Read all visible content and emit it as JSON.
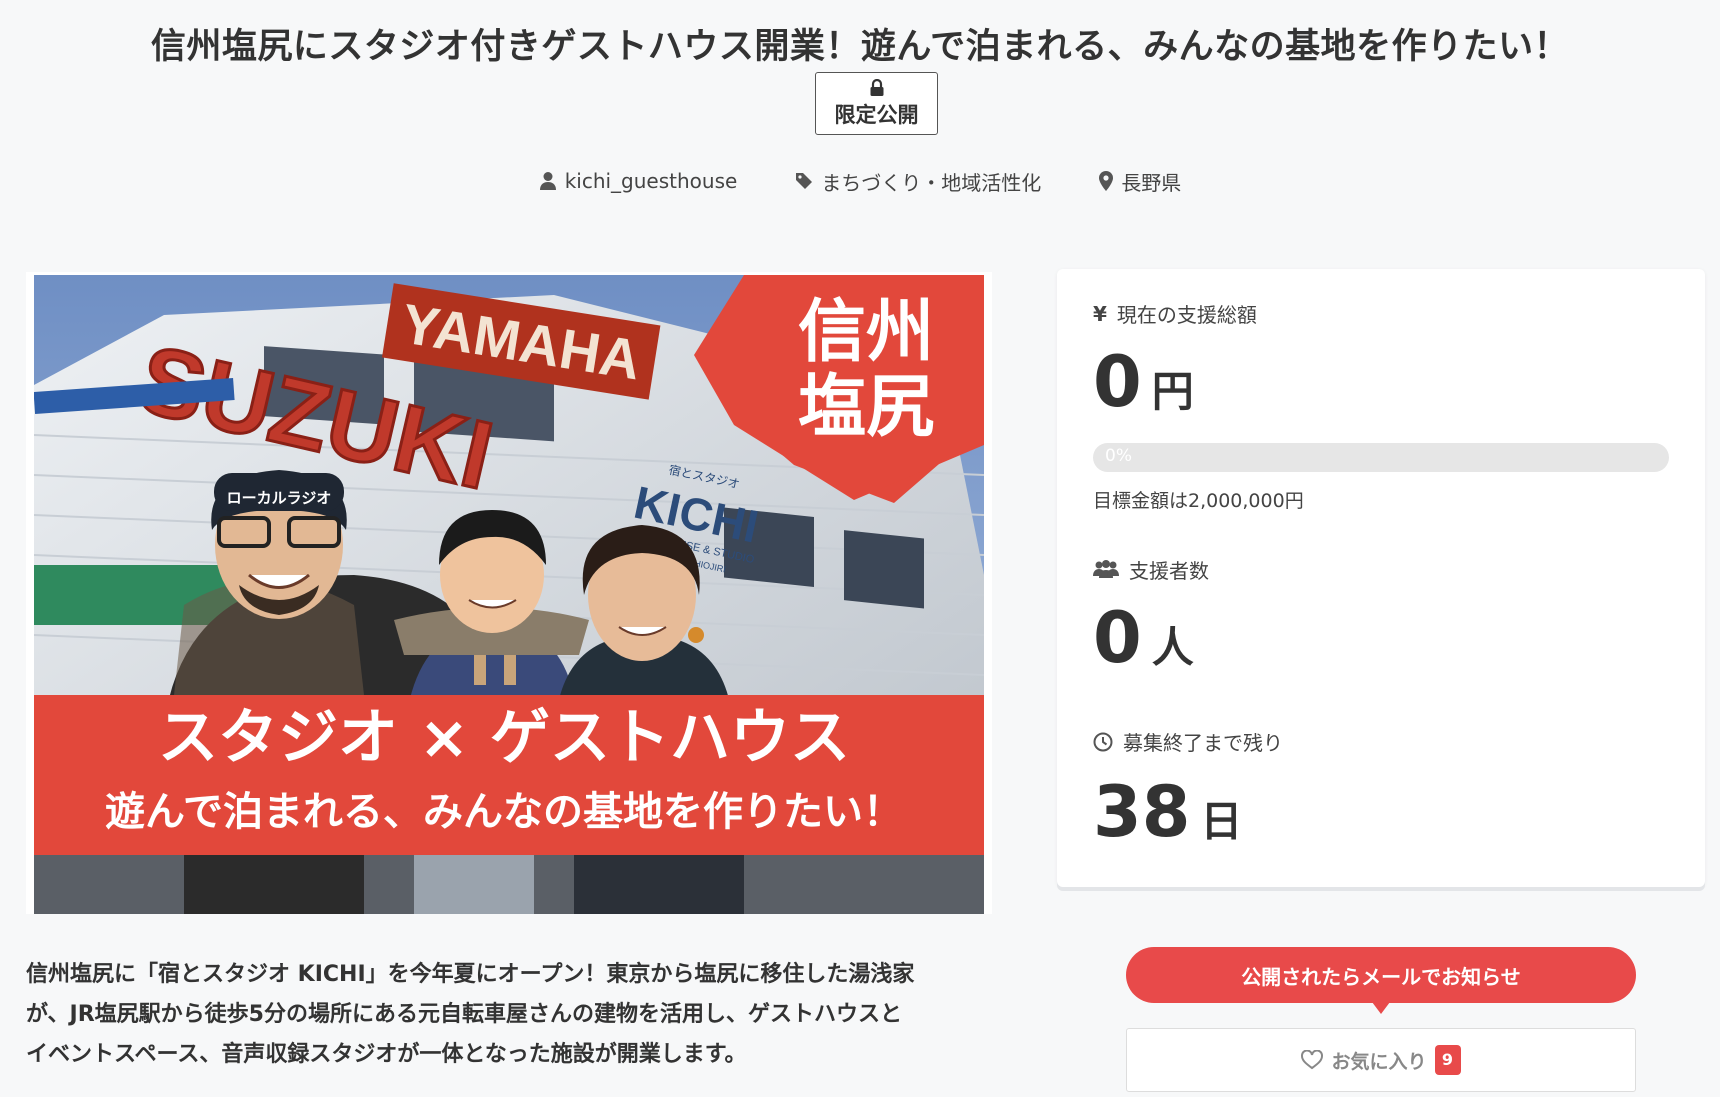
{
  "project": {
    "title": "信州塩尻にスタジオ付きゲストハウス開業！遊んで泊まれる、みんなの基地を作りたい！",
    "badge": "限定公開",
    "owner": "kichi_guesthouse",
    "category": "まちづくり・地域活性化",
    "location": "長野県"
  },
  "hero": {
    "corner_line1": "信州",
    "corner_line2": "塩尻",
    "banner_line1": "スタジオ × ゲストハウス",
    "banner_line2": "遊んで泊まれる、みんなの基地を作りたい！",
    "sign_yamaha": "YAMAHA",
    "sign_suzuki": "SUZUKI",
    "sign_kichi_small": "宿とスタジオ",
    "sign_kichi": "KICHI",
    "sign_kichi_sub": "GUESTHOUSE & STUDIO",
    "sign_kichi_sub2": "SHINSYU SHIOJIRI",
    "cap_text": "ローカルラジオ",
    "description": "Photo of a family of three in front of a building with YAMAHA and SUZUKI signs"
  },
  "description_lines": [
    "信州塩尻に「宿とスタジオ KICHI」を今年夏にオープン！東京から塩尻に移住した湯浅家",
    "が、JR塩尻駅から徒歩5分の場所にある元自転車屋さんの建物を活用し、ゲストハウスと",
    "イベントスペース、音声収録スタジオが一体となった施設が開業します。"
  ],
  "stats": {
    "amount_label": "現在の支援総額",
    "amount_value": "0",
    "amount_unit": "円",
    "progress_percent": 0,
    "progress_label": "0%",
    "goal_text": "目標金額は2,000,000円",
    "supporters_label": "支援者数",
    "supporters_value": "0",
    "supporters_unit": "人",
    "remaining_label": "募集終了まで残り",
    "remaining_value": "38",
    "remaining_unit": "日"
  },
  "actions": {
    "notify_label": "公開されたらメールでお知らせ",
    "favorite_label": "お気に入り",
    "favorite_count": "9"
  },
  "colors": {
    "accent": "#e84a4a",
    "banner_red": "#e2483b"
  },
  "icons": [
    "lock-icon",
    "user-icon",
    "tag-icon",
    "location-icon",
    "yen-icon",
    "users-icon",
    "clock-icon",
    "heart-icon"
  ]
}
